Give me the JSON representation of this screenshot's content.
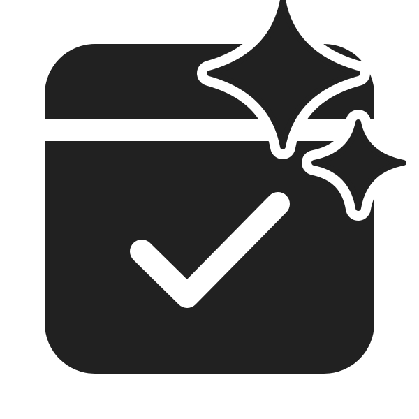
{
  "icon": {
    "name": "calendar-checkmark-sparkle-icon",
    "parts": [
      "calendar-icon",
      "checkmark-icon",
      "sparkle-icon"
    ],
    "colors": {
      "glyph": "#212121",
      "background": "#ffffff"
    }
  }
}
